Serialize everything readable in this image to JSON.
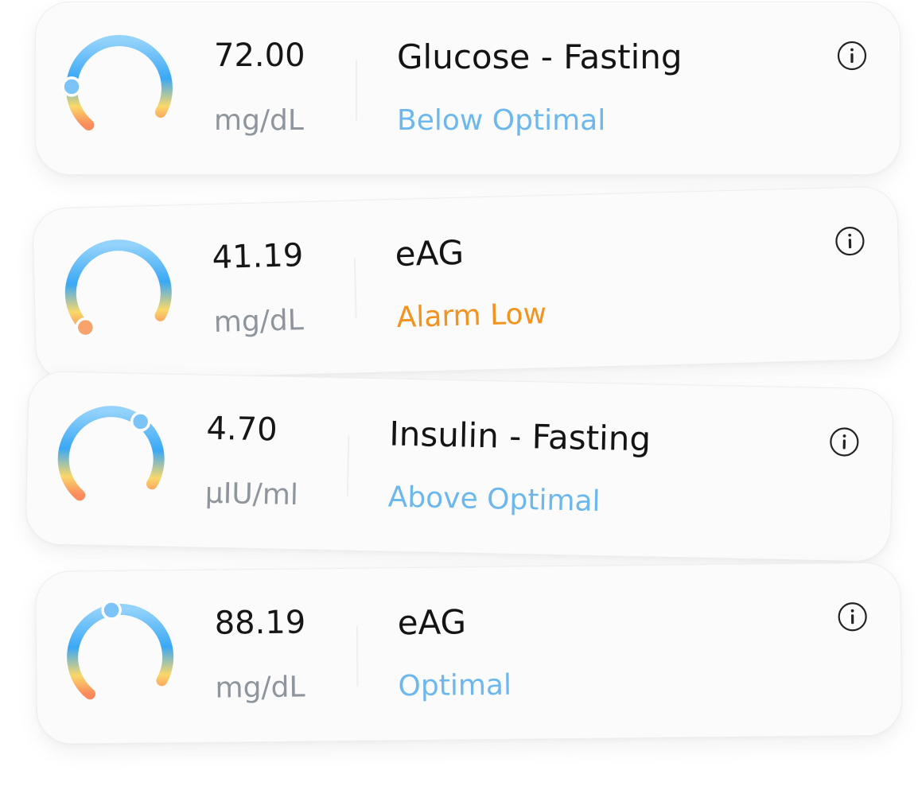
{
  "cards": [
    {
      "value": "72.00",
      "unit": "mg/dL",
      "title": "Glucose - Fasting",
      "status": "Below Optimal",
      "status_color": "#6cb8ee",
      "gauge_level": 0.2,
      "info_icon": "info-icon"
    },
    {
      "value": "41.19",
      "unit": "mg/dL",
      "title": "eAG",
      "status": "Alarm Low",
      "status_color": "#f3921d",
      "gauge_level": 0.02,
      "info_icon": "info-icon"
    },
    {
      "value": "4.70",
      "unit": "µIU/ml",
      "title": "Insulin - Fasting",
      "status": "Above Optimal",
      "status_color": "#6cb8ee",
      "gauge_level": 0.68,
      "info_icon": "info-icon"
    },
    {
      "value": "88.19",
      "unit": "mg/dL",
      "title": "eAG",
      "status": "Optimal",
      "status_color": "#6cb8ee",
      "gauge_level": 0.5,
      "info_icon": "info-icon"
    }
  ],
  "colors": {
    "gauge_blue": "#3aa8f5",
    "gauge_light_blue": "#93d2fb",
    "gauge_yellow": "#f9d86a",
    "gauge_orange": "#fb8a5c",
    "marker_blue": "#7cc4f7",
    "marker_orange": "#f7a36b"
  }
}
